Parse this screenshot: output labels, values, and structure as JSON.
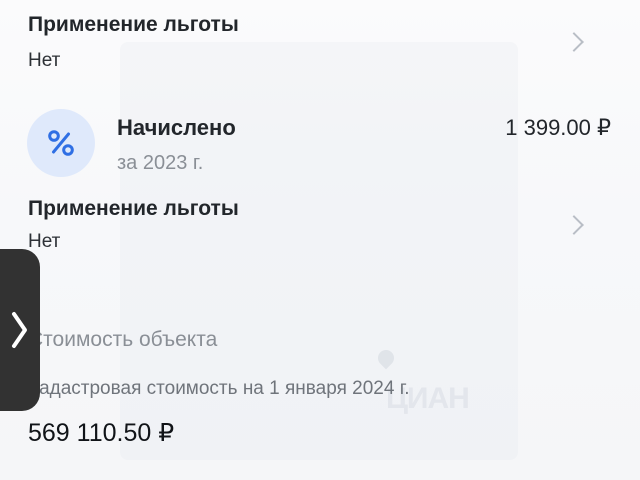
{
  "first_row": {
    "title": "Применение льготы",
    "value": "Нет"
  },
  "accrual": {
    "title": "Начислено",
    "period": "за 2023 г.",
    "amount": "1 399.00 ₽",
    "icon": "percent-icon"
  },
  "second_row": {
    "title": "Применение льготы",
    "value": "Нет"
  },
  "property_value": {
    "section_title": "Стоимость объекта",
    "cadastral_label": "Кадастровая стоимость на 1 января 2024 г.",
    "cadastral_value": "569 110.50 ₽"
  },
  "side_handle": {
    "icon": "chevron-right-icon"
  },
  "colors": {
    "accent": "#2f6fe4",
    "icon_bg": "#dfe9fb",
    "muted_text": "#8a8f96",
    "handle_bg": "#323232"
  }
}
